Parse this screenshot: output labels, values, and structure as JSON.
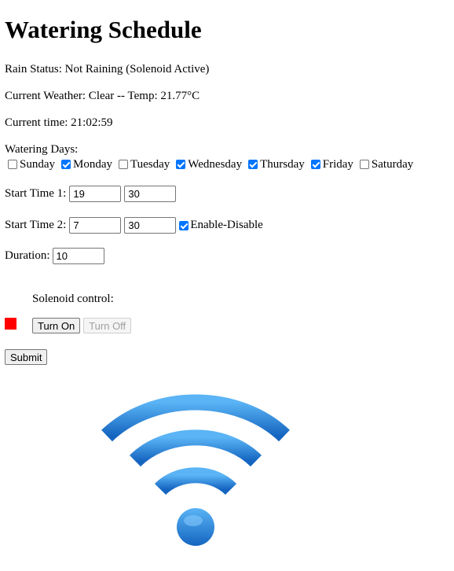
{
  "title": "Watering Schedule",
  "status": {
    "rain": "Rain Status: Not Raining (Solenoid Active)",
    "weather": "Current Weather: Clear -- Temp: 21.77°C",
    "time": "Current time: 21:02:59"
  },
  "watering_days": {
    "label": "Watering Days:",
    "days": [
      {
        "label": "Sunday",
        "checked": false
      },
      {
        "label": "Monday",
        "checked": true
      },
      {
        "label": "Tuesday",
        "checked": false
      },
      {
        "label": "Wednesday",
        "checked": true
      },
      {
        "label": "Thursday",
        "checked": true
      },
      {
        "label": "Friday",
        "checked": true
      },
      {
        "label": "Saturday",
        "checked": false
      }
    ]
  },
  "start_time_1": {
    "label": "Start Time 1:",
    "hour": "19",
    "minute": "30"
  },
  "start_time_2": {
    "label": "Start Time 2:",
    "hour": "7",
    "minute": "30",
    "enable_label": "Enable-Disable",
    "enabled": true
  },
  "duration": {
    "label": "Duration:",
    "value": "10"
  },
  "solenoid": {
    "label": "Solenoid control:",
    "indicator_color": "#ff0000",
    "turn_on_label": "Turn On",
    "turn_off_label": "Turn Off",
    "turn_off_disabled": true
  },
  "submit_label": "Submit",
  "wifi_icon": {
    "name": "wifi-icon",
    "color": "#1e88e5"
  }
}
